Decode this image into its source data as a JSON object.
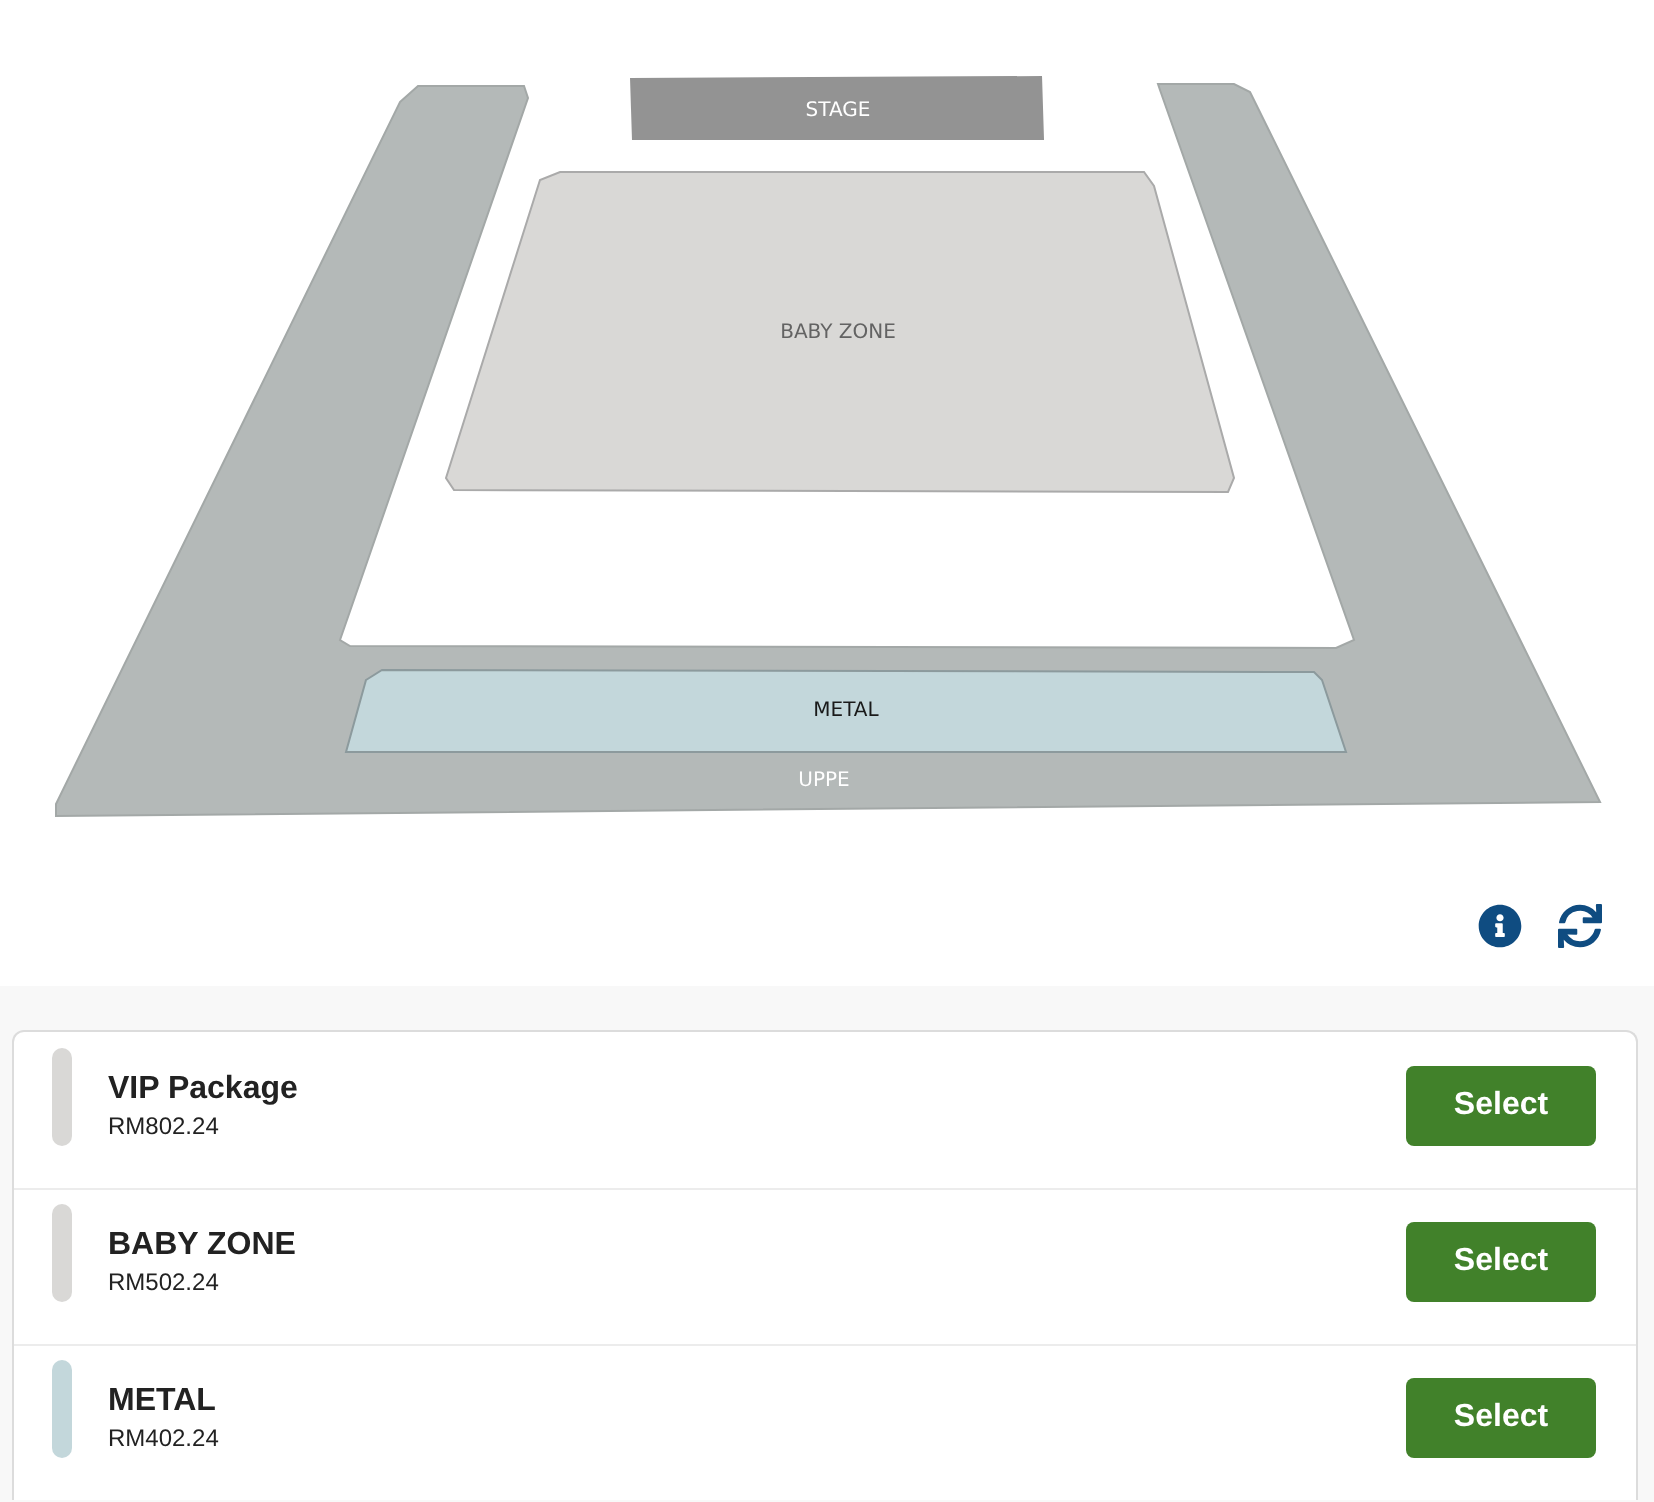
{
  "seat_map": {
    "sections": [
      {
        "kind": "stage",
        "label": "STAGE",
        "color": "#939393"
      },
      {
        "kind": "floor",
        "label": "BABY ZONE",
        "color": "#d9d8d6"
      },
      {
        "kind": "front",
        "label": "METAL",
        "color": "#c3d7db"
      },
      {
        "kind": "upper",
        "label": "UPPE",
        "color": "#b4b9b8"
      }
    ]
  },
  "tickets": [
    {
      "name": "VIP Package",
      "price": "RM802.24",
      "color": "#d9d8d6",
      "action": "Select"
    },
    {
      "name": "BABY ZONE",
      "price": "RM502.24",
      "color": "#d9d8d6",
      "action": "Select"
    },
    {
      "name": "METAL",
      "price": "RM402.24",
      "color": "#c3d7db",
      "action": "Select"
    }
  ]
}
